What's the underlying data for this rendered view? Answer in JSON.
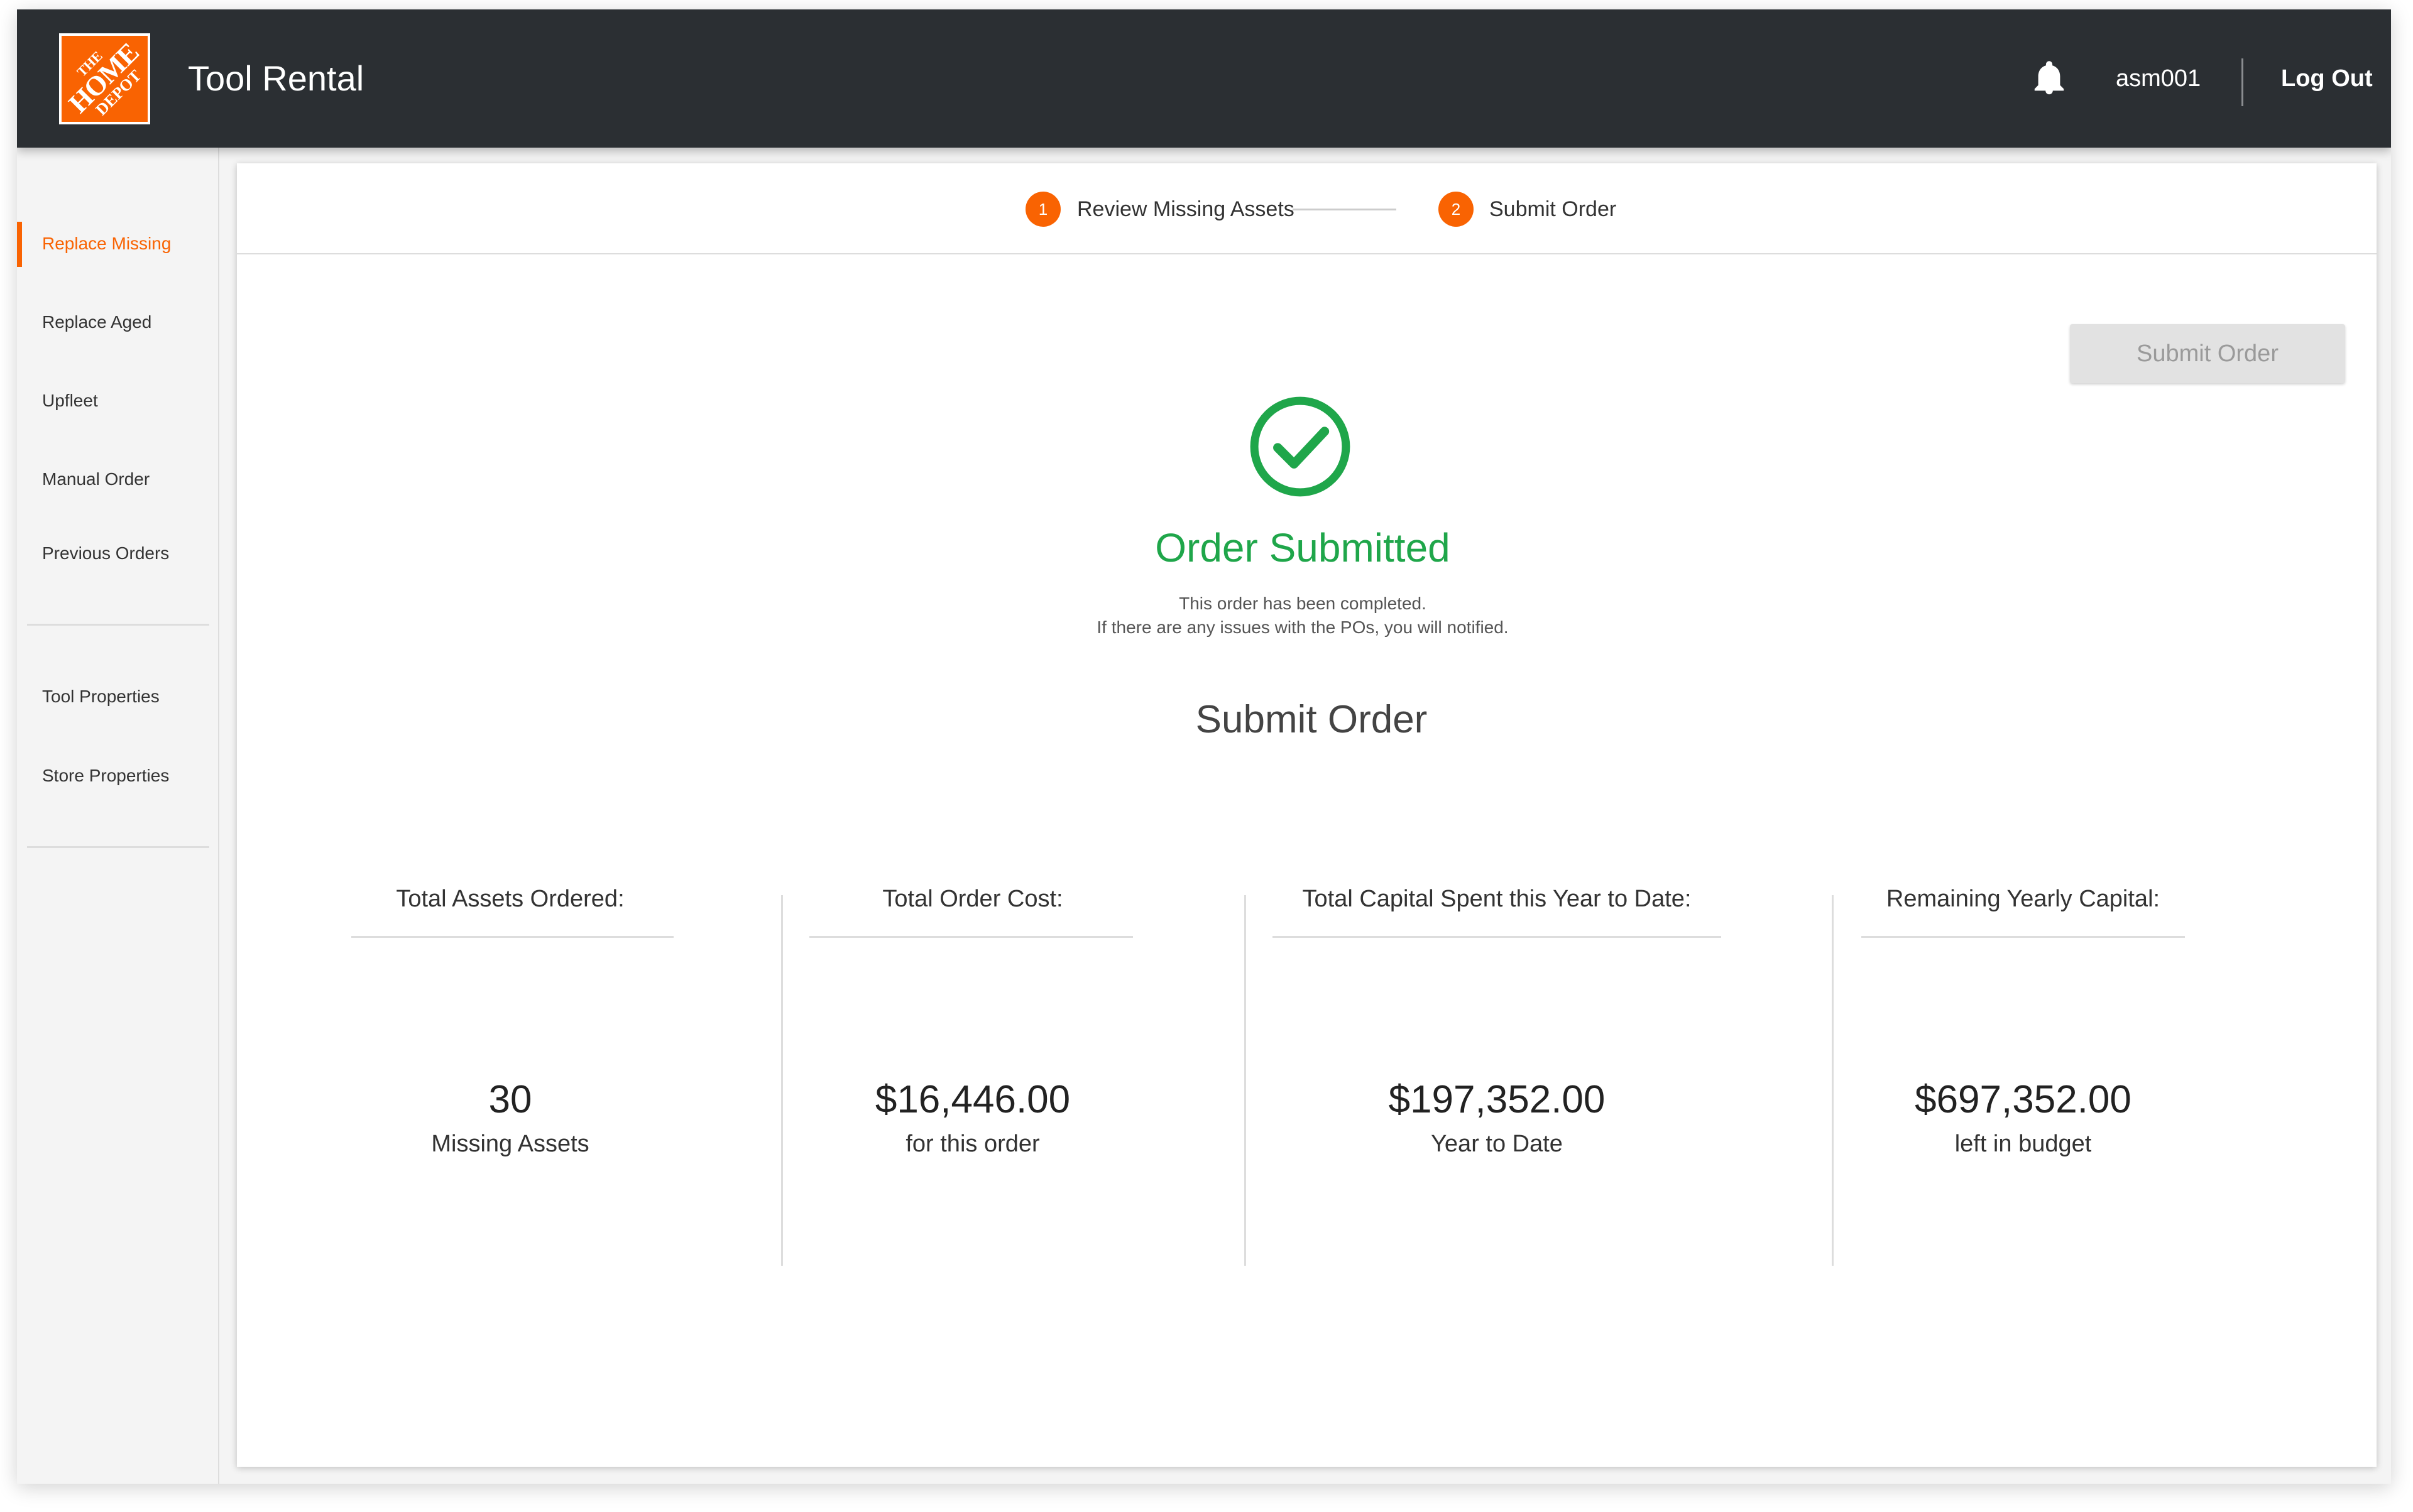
{
  "header": {
    "app_title": "Tool Rental",
    "username": "asm001",
    "logout_label": "Log Out",
    "logo_text": [
      "THE",
      "HOME",
      "DEPOT"
    ],
    "bell_icon": "bell-icon",
    "brand_color": "#f96302",
    "bar_color": "#2b2f33"
  },
  "sidebar": {
    "items": [
      {
        "label": "Replace Missing",
        "active": true
      },
      {
        "label": "Replace Aged"
      },
      {
        "label": "Upfleet"
      },
      {
        "label": "Manual Order"
      },
      {
        "label": "Previous Orders"
      },
      {
        "label": "Tool Properties"
      },
      {
        "label": "Store Properties"
      }
    ]
  },
  "stepper": {
    "steps": [
      {
        "number": "1",
        "label": "Review Missing Assets"
      },
      {
        "number": "2",
        "label": "Submit Order"
      }
    ]
  },
  "actions": {
    "submit_label": "Submit Order"
  },
  "status": {
    "icon": "check-circle-icon",
    "title": "Order Submitted",
    "line1": "This order has been completed.",
    "line2": "If there are any issues with the POs, you will notified.",
    "color": "#1fa64a"
  },
  "summary": {
    "title": "Submit Order",
    "stats": [
      {
        "heading": "Total Assets Ordered:",
        "value": "30",
        "sub": "Missing Assets"
      },
      {
        "heading": "Total Order Cost:",
        "value": "$16,446.00",
        "sub": "for this order"
      },
      {
        "heading": "Total Capital Spent this Year to Date:",
        "value": "$197,352.00",
        "sub": "Year to Date"
      },
      {
        "heading": "Remaining Yearly Capital:",
        "value": "$697,352.00",
        "sub": "left in budget"
      }
    ]
  }
}
